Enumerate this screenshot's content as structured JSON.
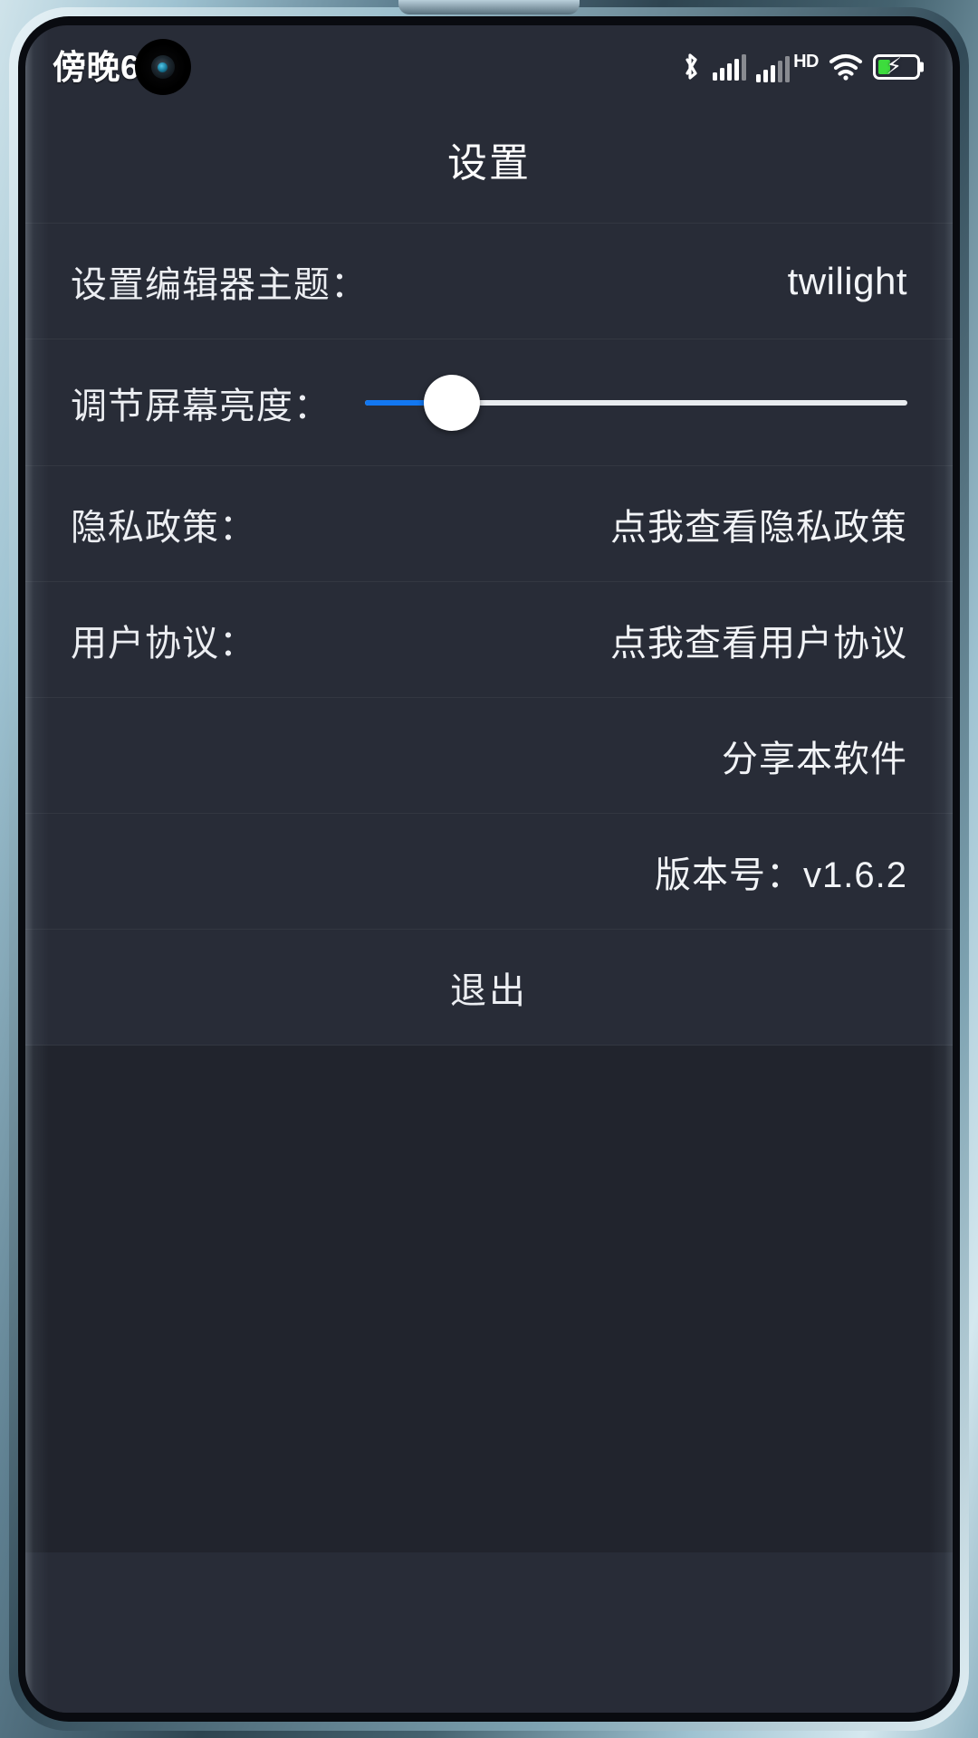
{
  "status_bar": {
    "clock": "傍晚6:",
    "camera_icon": "camera-punch-hole",
    "bluetooth_icon": "bluetooth-icon",
    "signal_icon": "cellular-signal-icon",
    "hd_label": "HD",
    "signal2_icon": "cellular-signal-2-icon",
    "wifi_icon": "wifi-icon",
    "battery_icon": "battery-charging-icon",
    "battery_level_percent": 32,
    "battery_color": "#3ddc3d"
  },
  "header": {
    "title": "设置"
  },
  "theme": {
    "background": "#282c37",
    "text": "#eceef2",
    "accent": "#1277f0",
    "divider": "rgba(255,255,255,0.055)"
  },
  "settings": {
    "rows": [
      {
        "label": "设置编辑器主题：",
        "value": "twilight",
        "type": "value"
      },
      {
        "label": "调节屏幕亮度：",
        "value": "",
        "type": "slider",
        "slider_percent": 16
      },
      {
        "label": "隐私政策：",
        "value": "点我查看隐私政策",
        "type": "link"
      },
      {
        "label": "用户协议：",
        "value": "点我查看用户协议",
        "type": "link"
      },
      {
        "label": "",
        "value": "分享本软件",
        "type": "action"
      },
      {
        "label": "",
        "value": "版本号：v1.6.2",
        "type": "info"
      },
      {
        "label": "",
        "value": "退出",
        "type": "center-action"
      }
    ]
  }
}
